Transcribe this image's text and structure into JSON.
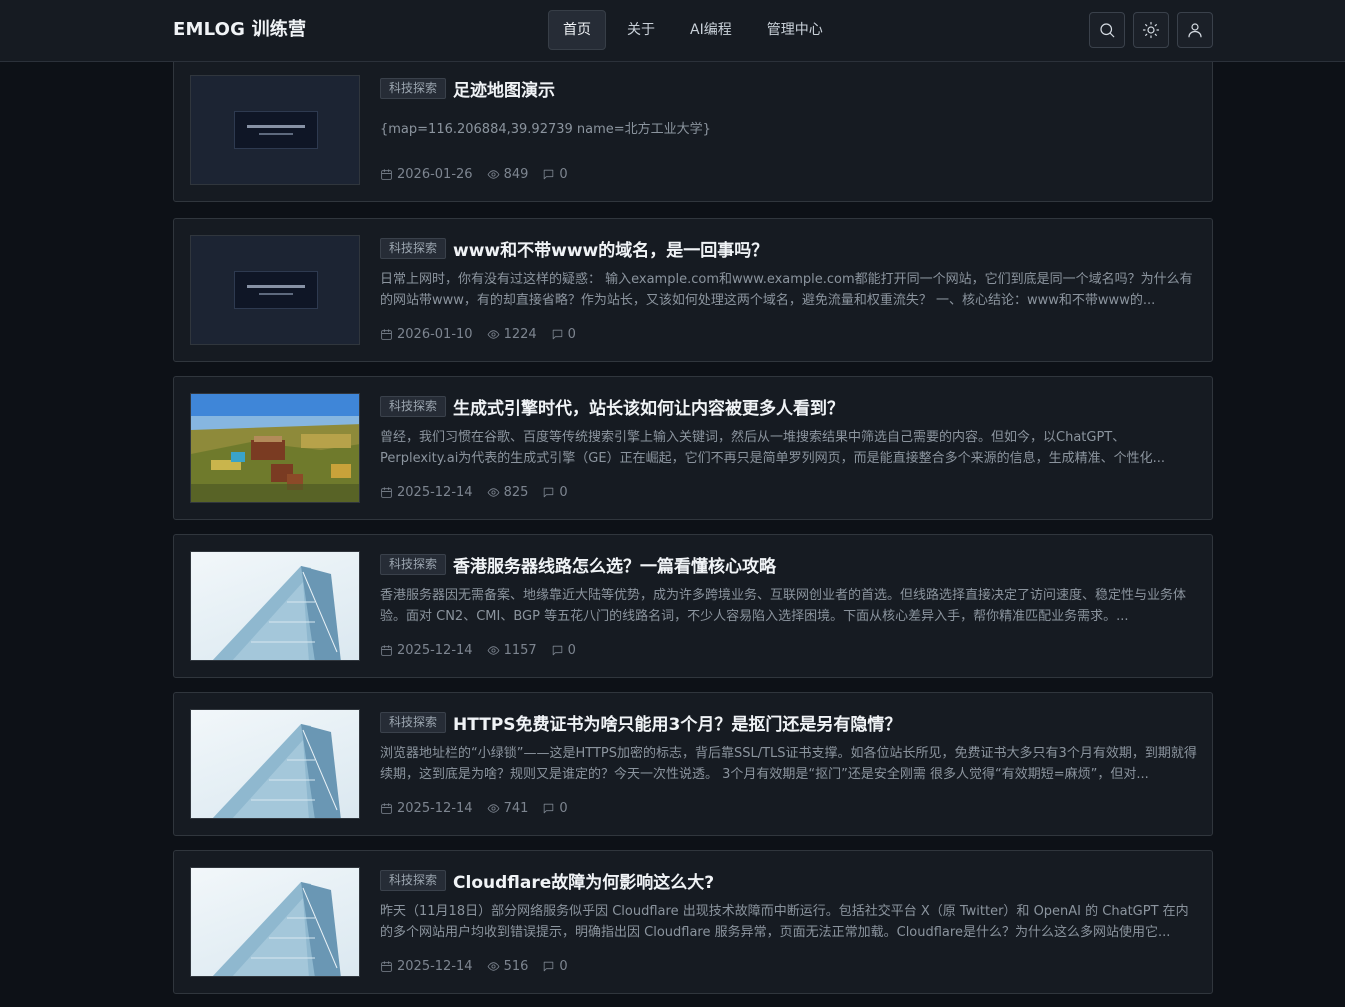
{
  "header": {
    "brand": "EMLOG 训练营",
    "nav": [
      {
        "label": "首页",
        "active": true
      },
      {
        "label": "关于",
        "active": false
      },
      {
        "label": "AI编程",
        "active": false
      },
      {
        "label": "管理中心",
        "active": false
      }
    ],
    "buttons": [
      "search-icon",
      "sun-icon",
      "user-icon"
    ]
  },
  "posts": [
    {
      "category": "科技探索",
      "title": "足迹地图演示",
      "excerpt": "{map=116.206884,39.92739 name=北方工业大学}",
      "date": "2026-01-26",
      "views": "849",
      "comments": "0",
      "thumb": "placeholder"
    },
    {
      "category": "科技探索",
      "title": "www和不带www的域名，是一回事吗？",
      "excerpt": "日常上网时，你有没有过这样的疑惑： 输入example.com和www.example.com都能打开同一个网站，它们到底是同一个域名吗？为什么有的网站带www，有的却直接省略？作为站长，又该如何处理这两个域名，避免流量和权重流失？ 一、核心结论：www和不带www的...",
      "date": "2026-01-10",
      "views": "1224",
      "comments": "0",
      "thumb": "placeholder"
    },
    {
      "category": "科技探索",
      "title": "生成式引擎时代，站长该如何让内容被更多人看到？",
      "excerpt": "曾经，我们习惯在谷歌、百度等传统搜索引擎上输入关键词，然后从一堆搜索结果中筛选自己需要的内容。但如今，以ChatGPT、Perplexity.ai为代表的生成式引擎（GE）正在崛起，它们不再只是简单罗列网页，而是能直接整合多个来源的信息，生成精准、个性化...",
      "date": "2025-12-14",
      "views": "825",
      "comments": "0",
      "thumb": "game"
    },
    {
      "category": "科技探索",
      "title": "香港服务器线路怎么选？一篇看懂核心攻略",
      "excerpt": "香港服务器因无需备案、地缘靠近大陆等优势，成为许多跨境业务、互联网创业者的首选。但线路选择直接决定了访问速度、稳定性与业务体验。面对 CN2、CMI、BGP 等五花八门的线路名词，不少人容易陷入选择困境。下面从核心差异入手，帮你精准匹配业务需求。...",
      "date": "2025-12-14",
      "views": "1157",
      "comments": "0",
      "thumb": "building"
    },
    {
      "category": "科技探索",
      "title": "HTTPS免费证书为啥只能用3个月？是抠门还是另有隐情？",
      "excerpt": "浏览器地址栏的“小绿锁”——这是HTTPS加密的标志，背后靠SSL/TLS证书支撑。如各位站长所见，免费证书大多只有3个月有效期，到期就得续期，这到底是为啥？规则又是谁定的？今天一次性说透。 3个月有效期是“抠门”还是安全刚需 很多人觉得“有效期短=麻烦”，但对...",
      "date": "2025-12-14",
      "views": "741",
      "comments": "0",
      "thumb": "building"
    },
    {
      "category": "科技探索",
      "title": "Cloudflare故障为何影响这么大?",
      "excerpt": "昨天（11月18日）部分网络服务似乎因 Cloudflare 出现技术故障而中断运行。包括社交平台 X（原 Twitter）和 OpenAI 的 ChatGPT 在内的多个网站用户均收到错误提示，明确指出因 Cloudflare 服务异常，页面无法正常加载。Cloudflare是什么？为什么这么多网站使用它...",
      "date": "2025-12-14",
      "views": "516",
      "comments": "0",
      "thumb": "building"
    }
  ]
}
